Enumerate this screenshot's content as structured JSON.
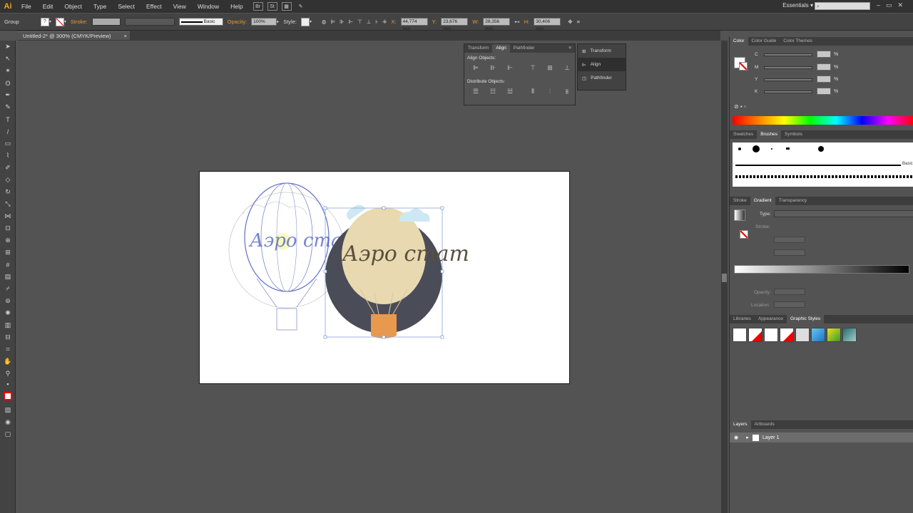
{
  "app": {
    "logo": "Ai",
    "app_buttons": [
      "Br",
      "St"
    ]
  },
  "menu": [
    "File",
    "Edit",
    "Object",
    "Type",
    "Select",
    "Effect",
    "View",
    "Window",
    "Help"
  ],
  "workspace": "Essentials",
  "control_bar": {
    "selection_label": "Group",
    "stroke_label": "Stroke:",
    "brush_label": "Basic",
    "opacity_label": "Opacity:",
    "opacity_value": "100%",
    "style_label": "Style:",
    "x_label": "X:",
    "x_value": "44,774 mm",
    "y_label": "Y:",
    "y_value": "23,676 mm",
    "w_label": "W:",
    "w_value": "28,356 mm",
    "h_label": "H:",
    "h_value": "30,406 mm"
  },
  "document_tab": "Untitled-2* @ 300% (CMYK/Preview)",
  "align_panel": {
    "tabs": [
      "Transform",
      "Align",
      "Pathfinder"
    ],
    "align_objects_label": "Align Objects:",
    "distribute_objects_label": "Distribute Objects:"
  },
  "dock_items": [
    "Transform",
    "Align",
    "Pathfinder"
  ],
  "color_panel": {
    "tabs": [
      "Color",
      "Color Guide",
      "Color Themes"
    ],
    "channels": [
      "C",
      "M",
      "Y",
      "K"
    ],
    "percent": "%"
  },
  "brushes_panel": {
    "tabs": [
      "Swatches",
      "Brushes",
      "Symbols"
    ],
    "basic_label": "Basic"
  },
  "gradient_panel": {
    "tabs": [
      "Stroke",
      "Gradient",
      "Transparency"
    ],
    "type_label": "Type:",
    "stroke_label": "Stroke:",
    "opacity_label": "Opacity:",
    "location_label": "Location:"
  },
  "styles_panel": {
    "tabs": [
      "Libraries",
      "Appearance",
      "Graphic Styles"
    ]
  },
  "layers_panel": {
    "tabs": [
      "Layers",
      "Artboards"
    ],
    "layer_name": "Layer 1"
  },
  "artwork": {
    "script_text": "Аэро стат",
    "sketch_text": "Аэро стат"
  },
  "colors": {
    "accent": "#f7a21b",
    "balloon_bg": "#4a4c57",
    "basket": "#e8994e",
    "balloon": "#e8d9b0",
    "cloud": "#cde8f2"
  }
}
